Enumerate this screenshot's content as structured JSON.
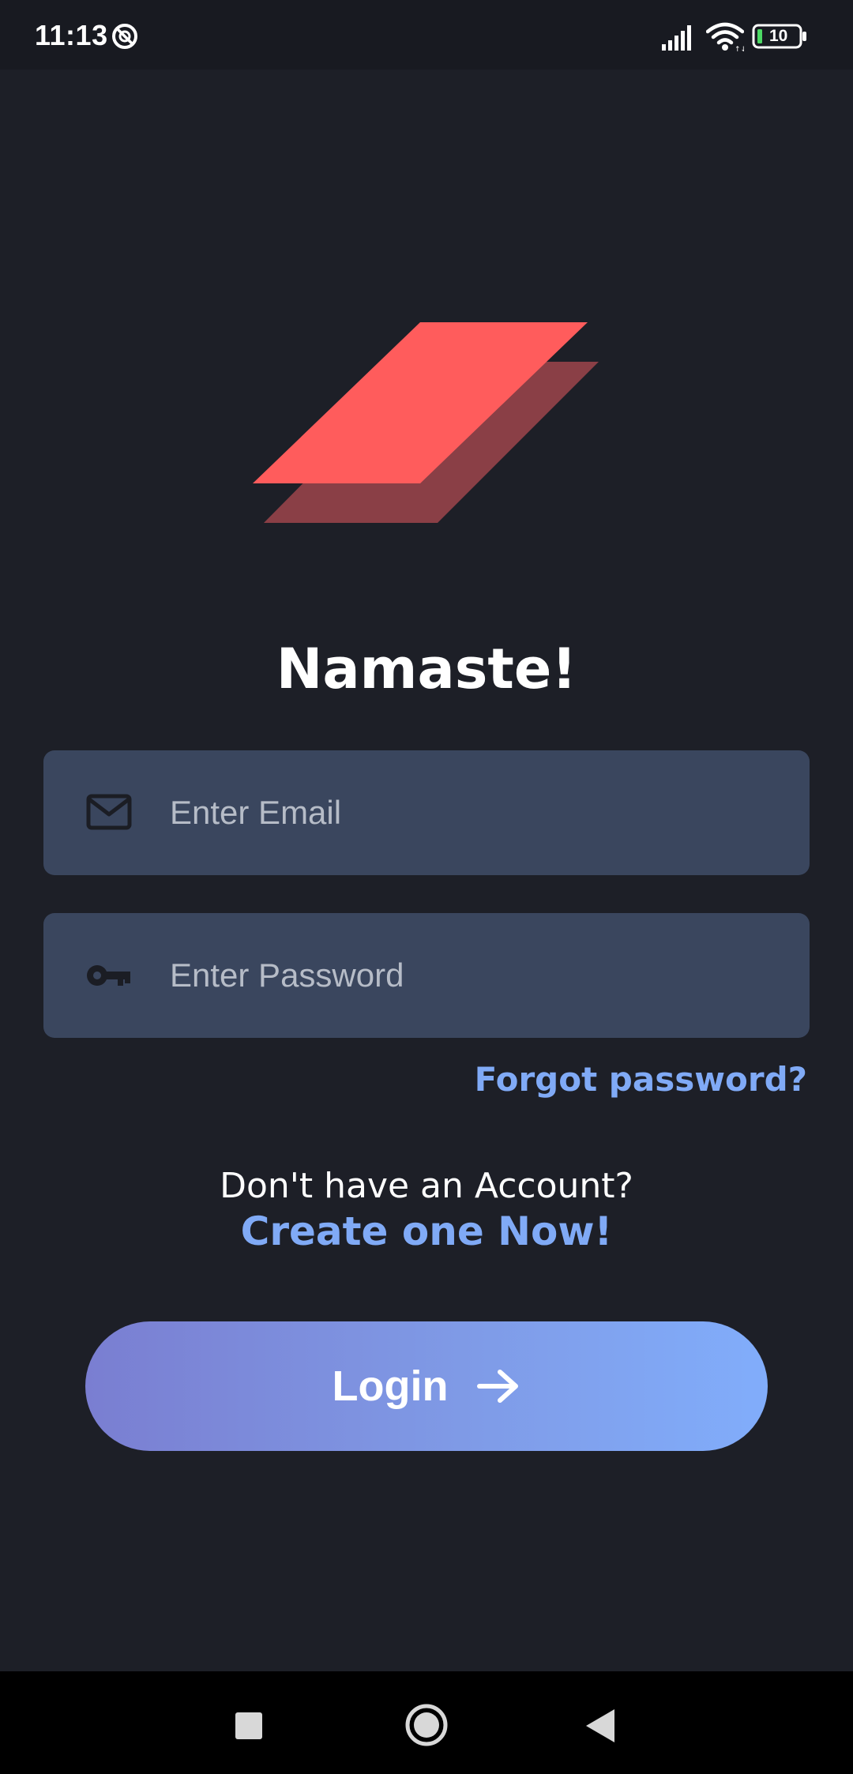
{
  "status_bar": {
    "time": "11:13",
    "battery_level": "10",
    "icons": [
      "do-not-disturb-icon",
      "signal-icon",
      "wifi-icon",
      "battery-icon"
    ]
  },
  "logo": {
    "icon": "layers-logo",
    "colors": {
      "front": "#ff5c5c",
      "back": "#8a3f46"
    }
  },
  "title": "Namaste!",
  "email": {
    "icon": "mail-icon",
    "placeholder": "Enter Email",
    "value": ""
  },
  "password": {
    "icon": "key-icon",
    "placeholder": "Enter Password",
    "value": ""
  },
  "forgot_password": "Forgot password?",
  "no_account_text": "Don't have an Account?",
  "create_account_link": "Create one Now!",
  "login_button": {
    "label": "Login",
    "icon": "arrow-right-icon"
  },
  "nav_bar": {
    "icons": [
      "recents-icon",
      "home-icon",
      "back-icon"
    ]
  },
  "colors": {
    "background": "#1d1f27",
    "field": "#3a465e",
    "link": "#80aaf6",
    "button_start": "#7a7ed1",
    "button_end": "#81adfb"
  }
}
